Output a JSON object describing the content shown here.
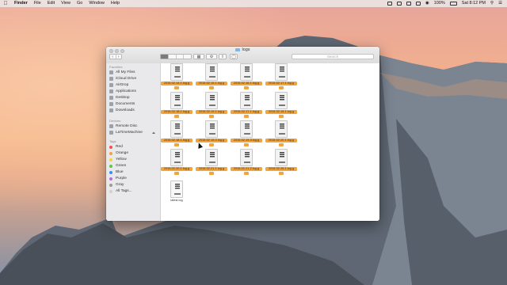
{
  "menubar": {
    "app_name": "Finder",
    "items": [
      "File",
      "Edit",
      "View",
      "Go",
      "Window",
      "Help"
    ],
    "battery": "100%",
    "clock": "Sat 8:12 PM"
  },
  "window": {
    "title": "logs",
    "search_placeholder": "Search"
  },
  "sidebar": {
    "favorites_heading": "Favorites",
    "favorites": [
      {
        "label": "All My Files",
        "icon": "all-files-icon"
      },
      {
        "label": "iCloud Drive",
        "icon": "cloud-icon"
      },
      {
        "label": "AirDrop",
        "icon": "airdrop-icon"
      },
      {
        "label": "Applications",
        "icon": "applications-icon"
      },
      {
        "label": "Desktop",
        "icon": "desktop-icon"
      },
      {
        "label": "Documents",
        "icon": "documents-icon"
      },
      {
        "label": "Downloads",
        "icon": "downloads-icon"
      }
    ],
    "devices_heading": "Devices",
    "devices": [
      {
        "label": "Remote Disc",
        "icon": "disc-icon"
      },
      {
        "label": "LaTimeMachine",
        "icon": "drive-icon"
      }
    ],
    "tags_heading": "Tags",
    "tags": [
      {
        "label": "Red",
        "color": "#f0524f"
      },
      {
        "label": "Orange",
        "color": "#f6a23a"
      },
      {
        "label": "Yellow",
        "color": "#f5d43b"
      },
      {
        "label": "Green",
        "color": "#5bc74b"
      },
      {
        "label": "Blue",
        "color": "#3b8ff0"
      },
      {
        "label": "Purple",
        "color": "#bb6bd9"
      },
      {
        "label": "Gray",
        "color": "#9a9a9a"
      },
      {
        "label": "All Tags...",
        "color": "#d0d0d0"
      }
    ]
  },
  "files": [
    {
      "name": "2015-02-14-1.log.g",
      "tagged": true
    },
    {
      "name": "2015-02-15-1.log.g",
      "tagged": true
    },
    {
      "name": "2015-02-16-1.log.g",
      "tagged": true
    },
    {
      "name": "2015-02-17-1.log.g",
      "tagged": true
    },
    {
      "name": "2015-02-18-1.log.g",
      "tagged": true
    },
    {
      "name": "2015-02-19-1.log.g",
      "tagged": true
    },
    {
      "name": "2015-02-17-1.log.g",
      "tagged": true
    },
    {
      "name": "2015-02-18-1.log.g",
      "tagged": true
    },
    {
      "name": "2015-02-18-1.log.g",
      "tagged": true
    },
    {
      "name": "2015-02-19-2.log.g",
      "tagged": true
    },
    {
      "name": "2015-02-19-3.log.g",
      "tagged": true
    },
    {
      "name": "2015-02-20-1.log.g",
      "tagged": true
    },
    {
      "name": "2015-02-20-1.log.g",
      "tagged": true
    },
    {
      "name": "2015-02-21-1.log.g",
      "tagged": true
    },
    {
      "name": "2015-02-21-2.log.g",
      "tagged": true
    },
    {
      "name": "2015-02-26-1.log.g",
      "tagged": true
    },
    {
      "name": "latest.log",
      "tagged": false
    }
  ]
}
